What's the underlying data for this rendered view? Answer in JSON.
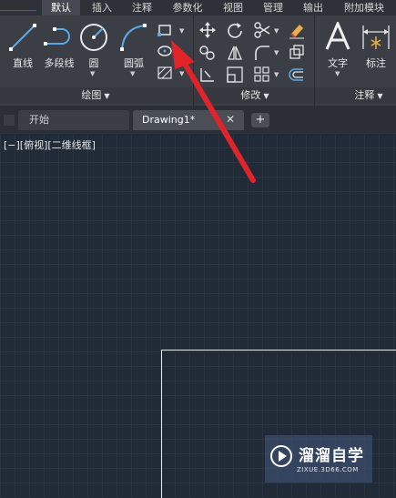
{
  "ribbon_tabs": [
    {
      "label": "默认",
      "active": true
    },
    {
      "label": "插入",
      "active": false
    },
    {
      "label": "注释",
      "active": false
    },
    {
      "label": "参数化",
      "active": false
    },
    {
      "label": "视图",
      "active": false
    },
    {
      "label": "管理",
      "active": false
    },
    {
      "label": "输出",
      "active": false
    },
    {
      "label": "附加模块",
      "active": false
    }
  ],
  "draw_panel": {
    "title": "绘图",
    "tools": {
      "line": "直线",
      "polyline": "多段线",
      "circle": "圆",
      "arc": "圆弧"
    }
  },
  "modify_panel": {
    "title": "修改"
  },
  "annotation_panel": {
    "title": "注释",
    "tools": {
      "text": "文字",
      "dimension": "标注"
    }
  },
  "doc_tabs": [
    {
      "label": "开始",
      "active": false
    },
    {
      "label": "Drawing1*",
      "active": true
    }
  ],
  "viewport_label": "[−][俯视][二维线框]",
  "watermark": {
    "title": "溜溜自学",
    "url": "ZIXUE.3D66.COM"
  },
  "colors": {
    "ribbon_bg": "#3b3e45",
    "canvas_bg": "#212a37",
    "tool_blue": "#5aa9e6",
    "annotation_arrow": "#e0242a"
  }
}
